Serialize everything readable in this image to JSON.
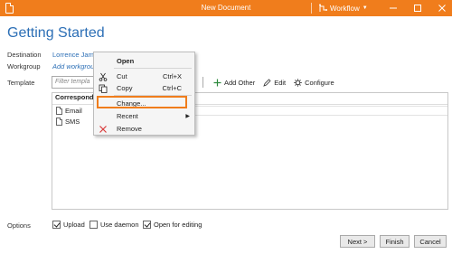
{
  "window": {
    "title": "New Document",
    "workflow_label": "Workflow",
    "minimize_icon": "minimize-icon",
    "maximize_icon": "maximize-icon",
    "close_icon": "close-icon"
  },
  "page": {
    "heading": "Getting Started"
  },
  "fields": {
    "destination_label": "Destination",
    "destination_value": "Lorrence Jam",
    "workgroup_label": "Workgroup",
    "workgroup_value": "Add workgrou",
    "template_label": "Template"
  },
  "template": {
    "filter_placeholder": "Filter templa",
    "toolbar": {
      "add_other": "Add Other",
      "edit": "Edit",
      "configure": "Configure"
    },
    "list_header": "Corresponde",
    "items": [
      {
        "label": "Email"
      },
      {
        "label": "SMS"
      }
    ]
  },
  "context_menu": {
    "items": [
      {
        "label": "Open",
        "shortcut": "",
        "icon": "",
        "bold": true
      },
      {
        "label": "Cut",
        "shortcut": "Ctrl+X",
        "icon": "scissors-icon"
      },
      {
        "label": "Copy",
        "shortcut": "Ctrl+C",
        "icon": "copy-icon"
      },
      {
        "label": "Change...",
        "shortcut": "",
        "icon": ""
      },
      {
        "label": "Recent",
        "shortcut": "",
        "icon": "",
        "submenu": true
      },
      {
        "label": "Remove",
        "shortcut": "",
        "icon": "remove-icon"
      }
    ],
    "highlight_color": "#f07d1c"
  },
  "options": {
    "label": "Options",
    "upload": {
      "label": "Upload",
      "checked": true
    },
    "use_daemon": {
      "label": "Use daemon",
      "checked": false
    },
    "open_for_editing": {
      "label": "Open for editing",
      "checked": true
    }
  },
  "buttons": {
    "next": "Next >",
    "finish": "Finish",
    "cancel": "Cancel"
  },
  "colors": {
    "accent": "#f07d1c",
    "link": "#2c6fb6"
  }
}
